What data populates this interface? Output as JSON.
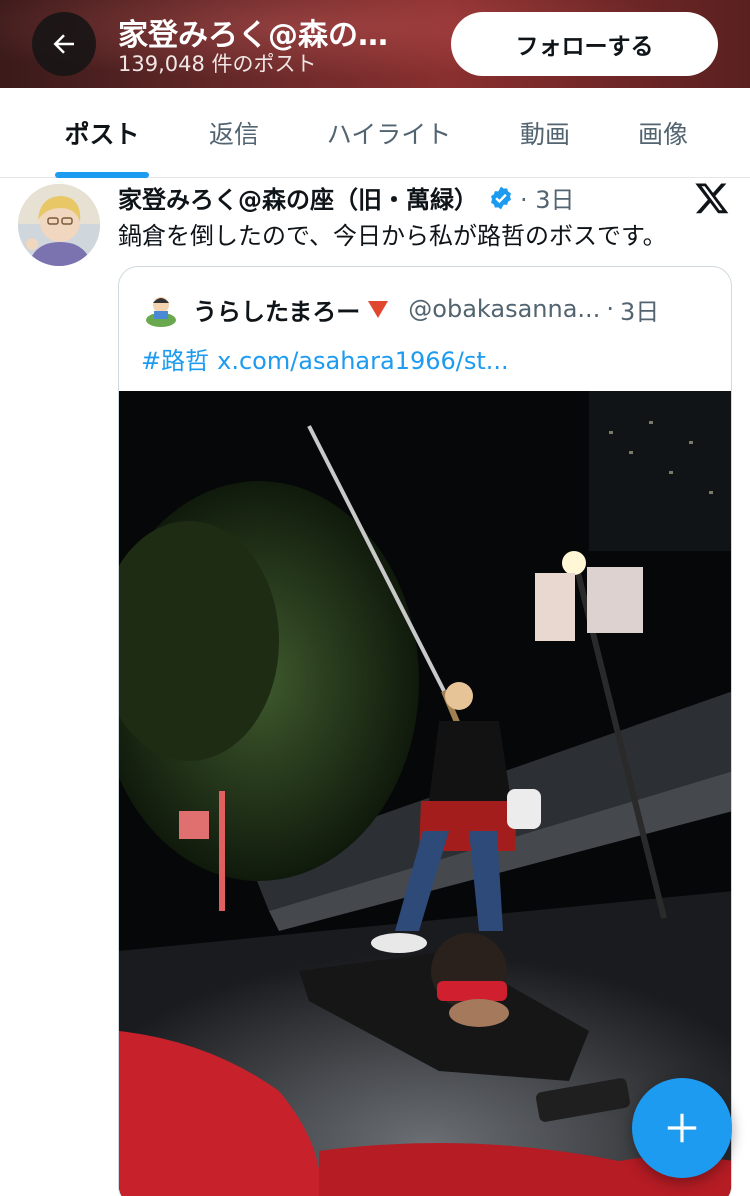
{
  "header": {
    "title": "家登みろく@森の…",
    "post_count": "139,048 件のポスト",
    "follow_label": "フォローする"
  },
  "tabs": [
    {
      "label": "ポスト",
      "active": true
    },
    {
      "label": "返信",
      "active": false
    },
    {
      "label": "ハイライト",
      "active": false
    },
    {
      "label": "動画",
      "active": false
    },
    {
      "label": "画像",
      "active": false
    }
  ],
  "post": {
    "author": "家登みろく@森の座（旧・萬緑）",
    "time": "3日",
    "text": "鍋倉を倒したので、今日から私が路哲のボスです。",
    "verified": true
  },
  "quote": {
    "author": "うらしたまろー",
    "flag_icon": "red-triangle-icon",
    "handle": "@obakasanna...",
    "dot": "·",
    "time": "3日",
    "hashtag": "#路哲",
    "link": "x.com/asahara1966/st..."
  },
  "colors": {
    "accent": "#1d9bf0",
    "text": "#0f1419",
    "secondary": "#536471"
  }
}
